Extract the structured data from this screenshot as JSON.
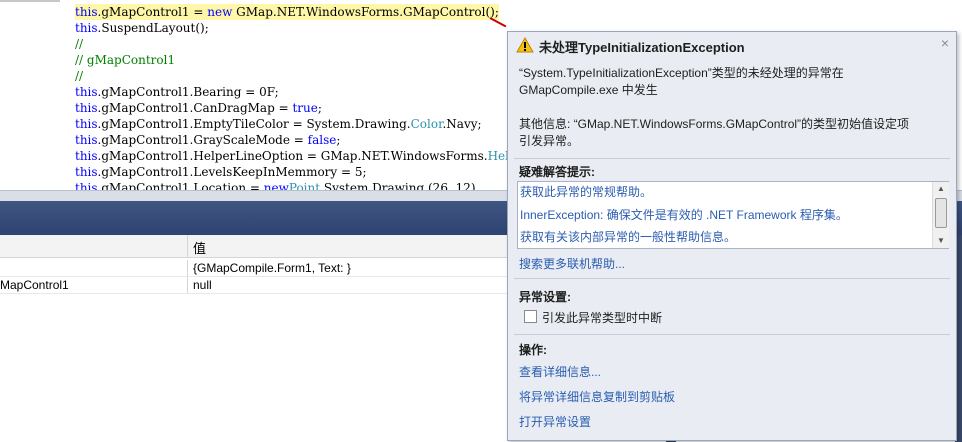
{
  "editor": {
    "lines": [
      {
        "prefix_kw": "this",
        "text": ".gMapControl1 = ",
        "kw2": "new",
        "rest": " GMap.NET.WindowsForms.GMapControl();",
        "highlight": true
      },
      {
        "prefix_kw": "this",
        "text": ".SuspendLayout();"
      },
      {
        "comment": "//"
      },
      {
        "comment": "// gMapControl1"
      },
      {
        "comment": "//"
      },
      {
        "prefix_kw": "this",
        "text": ".gMapControl1.Bearing = 0F;"
      },
      {
        "prefix_kw": "this",
        "text": ".gMapControl1.CanDragMap = ",
        "kw2": "true",
        "rest": ";"
      },
      {
        "prefix_kw": "this",
        "text": ".gMapControl1.EmptyTileColor = System.Drawing.",
        "type": "Color",
        "rest": ".Navy;"
      },
      {
        "prefix_kw": "this",
        "text": ".gMapControl1.GrayScaleMode = ",
        "kw2": "false",
        "rest": ";"
      },
      {
        "prefix_kw": "this",
        "text": ".gMapControl1.HelperLineOption = GMap.NET.WindowsForms.",
        "type": "Hel"
      },
      {
        "prefix_kw": "this",
        "text": ".gMapControl1.LevelsKeepInMemmory = 5;"
      },
      {
        "prefix_kw": "this",
        "text": ".gMapControl1.Location = ",
        "kw2": "new",
        "rest": " System.Drawing.",
        "type": "Point",
        "rest2": "(26, 12)"
      }
    ]
  },
  "locals": {
    "value_header": "值",
    "rows": [
      {
        "name": "",
        "value": "{GMapCompile.Form1, Text: }"
      },
      {
        "name": "MapControl1",
        "value": "null"
      }
    ]
  },
  "exception": {
    "title": "未处理TypeInitializationException",
    "close": "×",
    "message_line1": "“System.TypeInitializationException”类型的未经处理的异常在",
    "message_line2": "GMapCompile.exe 中发生",
    "info_line1": "其他信息:  “GMap.NET.WindowsForms.GMapControl”的类型初始值设定项",
    "info_line2": "引发异常。",
    "tips_title": "疑难解答提示:",
    "tips": [
      "获取此异常的常规帮助。",
      "InnerException: 确保文件是有效的 .NET Framework 程序集。",
      "获取有关该内部异常的一般性帮助信息。"
    ],
    "search_more": "搜索更多联机帮助...",
    "settings_title": "异常设置:",
    "break_checkbox_label": "引发此异常类型时中断",
    "break_checked": false,
    "actions_title": "操作:",
    "actions": [
      "查看详细信息...",
      "将异常详细信息复制到剪贴板",
      "打开异常设置"
    ]
  }
}
